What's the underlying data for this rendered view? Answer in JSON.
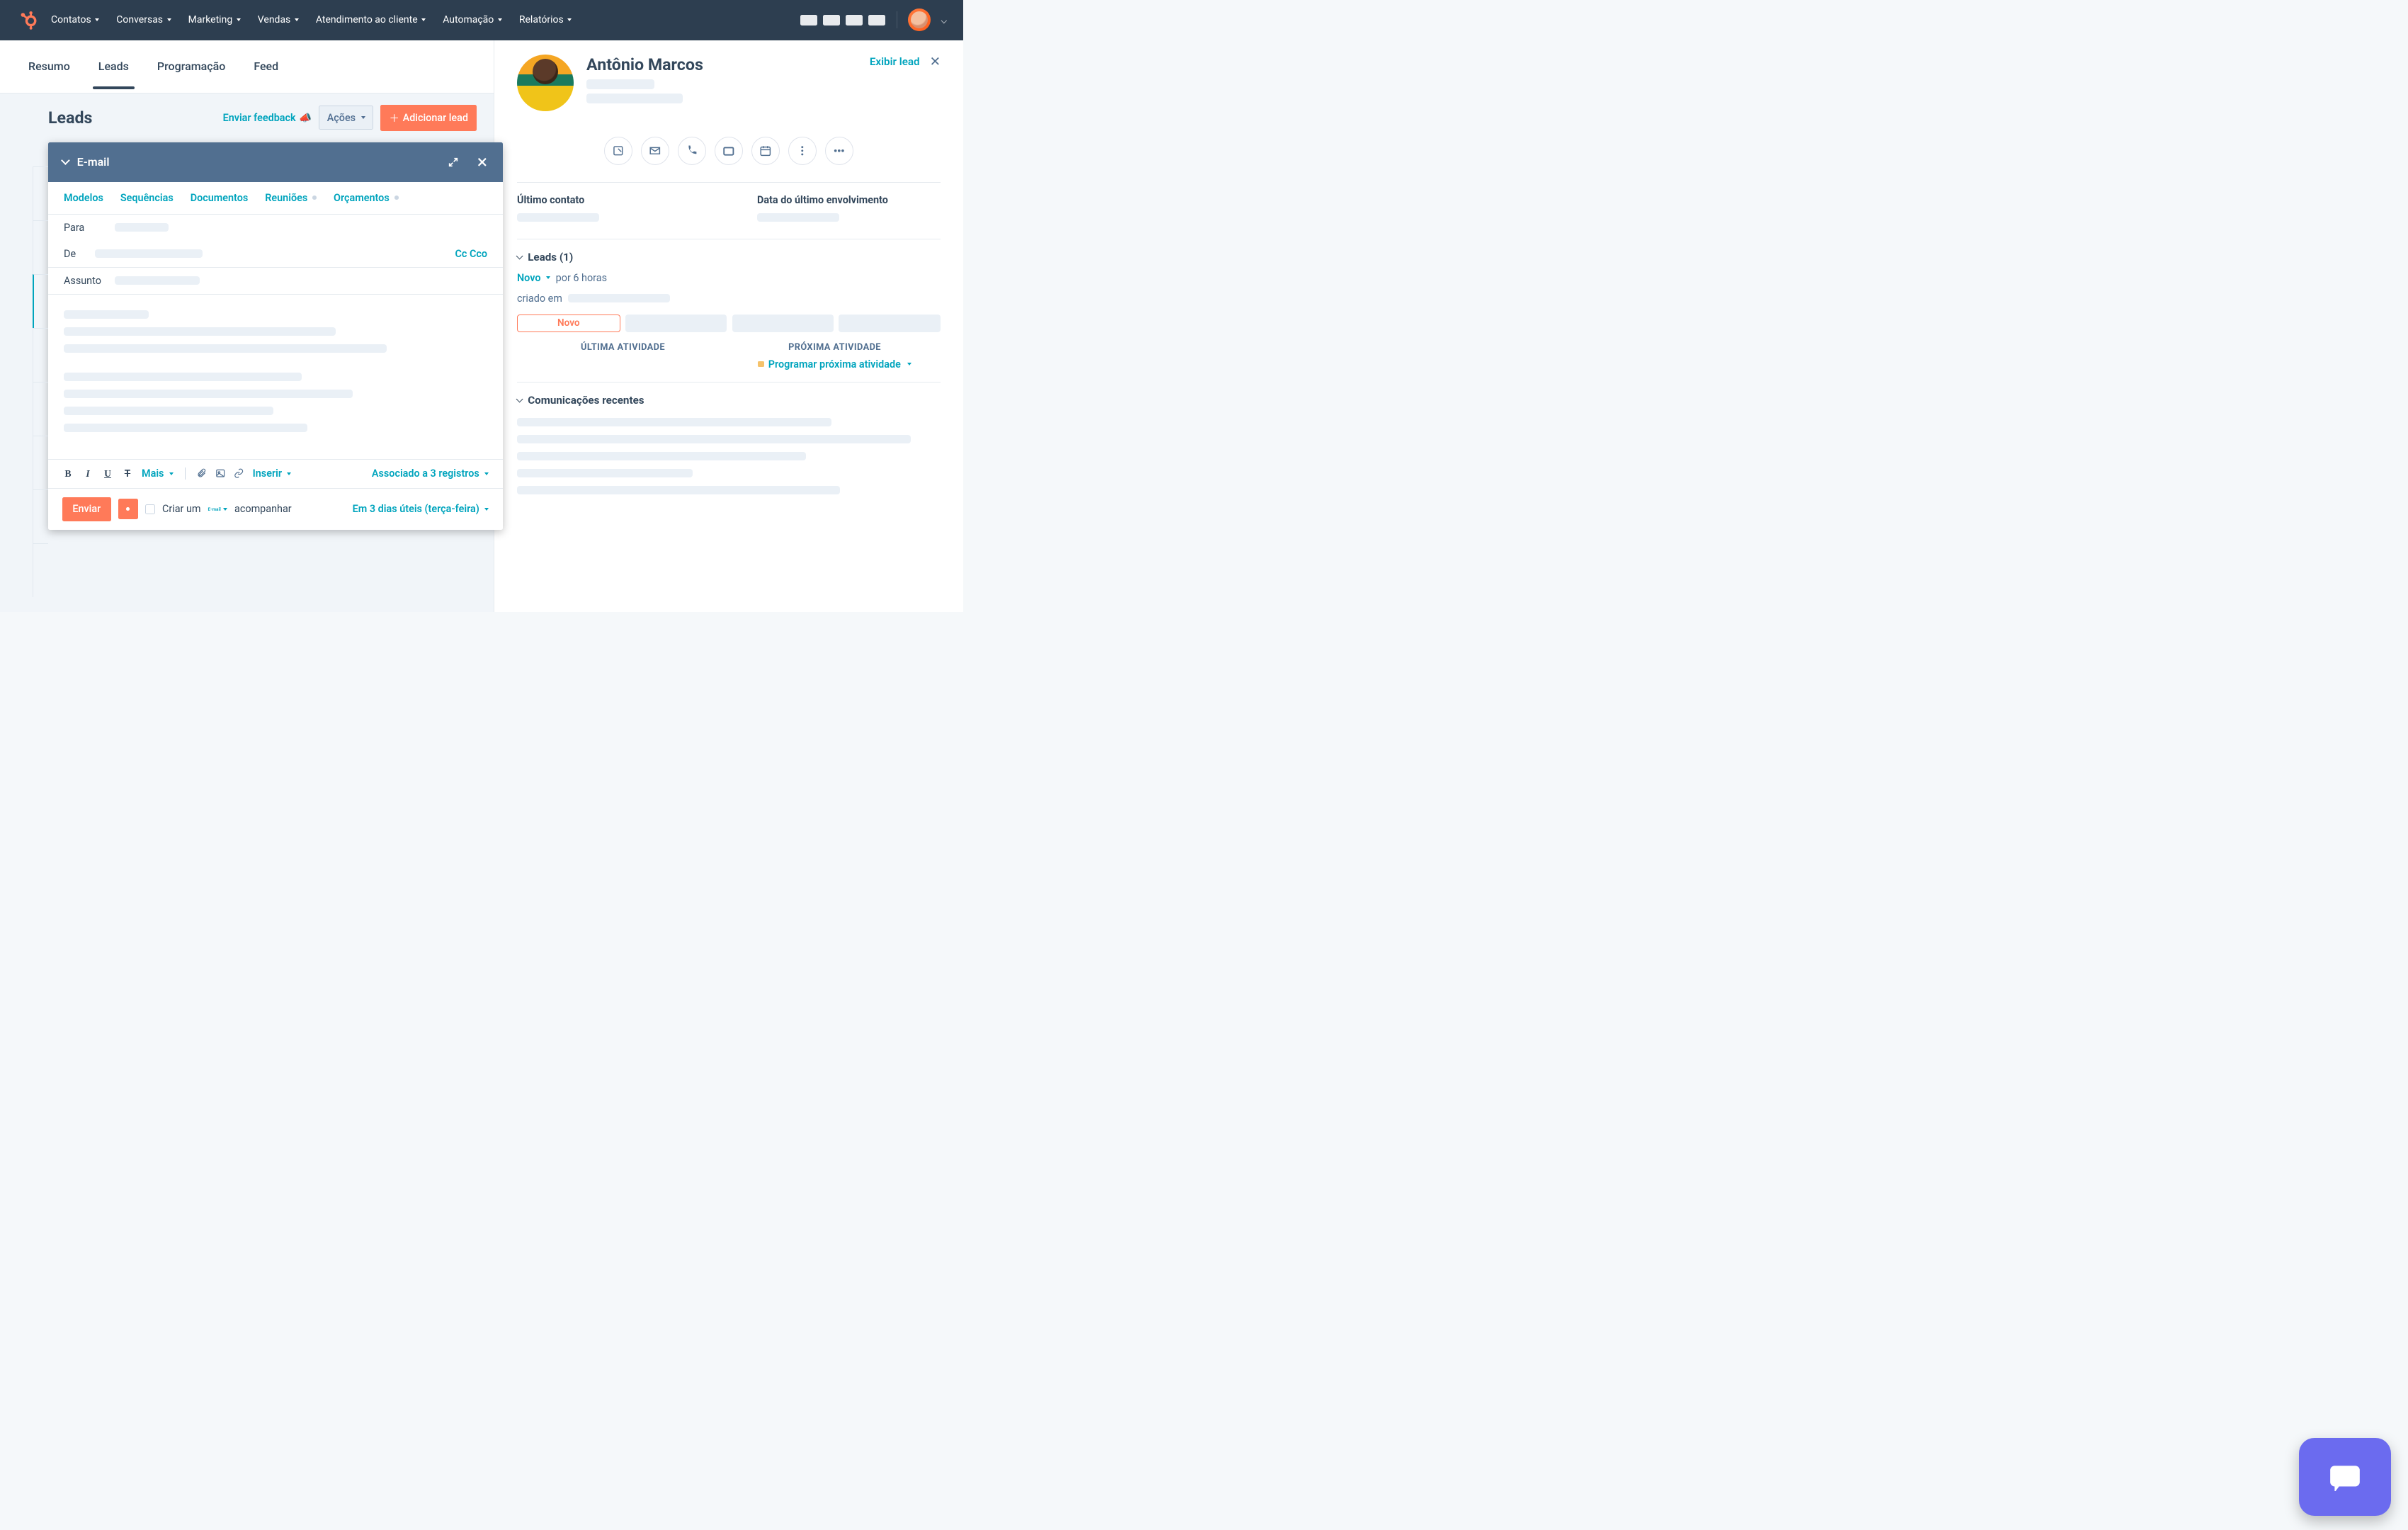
{
  "nav": {
    "items": [
      "Contatos",
      "Conversas",
      "Marketing",
      "Vendas",
      "Atendimento ao cliente",
      "Automação",
      "Relatórios"
    ]
  },
  "tabs": {
    "items": [
      "Resumo",
      "Leads",
      "Programação",
      "Feed"
    ],
    "activeIndex": 1
  },
  "leads": {
    "title": "Leads",
    "feedback": "Enviar feedback",
    "actions": "Ações",
    "add": "Adicionar lead"
  },
  "compose": {
    "title": "E-mail",
    "tabs": [
      "Modelos",
      "Sequências",
      "Documentos",
      "Reuniões",
      "Orçamentos"
    ],
    "toLabel": "Para",
    "fromLabel": "De",
    "cc": "Cc",
    "bcc": "Cco",
    "subjectLabel": "Assunto",
    "more": "Mais",
    "insert": "Inserir",
    "associated": "Associado a 3 registros",
    "send": "Enviar",
    "createA": "Criar um",
    "emailWord": "E-mail",
    "followUp": "acompanhar",
    "schedule": "Em 3 dias úteis (terça-feira)"
  },
  "contact": {
    "name": "Antônio Marcos",
    "viewLead": "Exibir lead",
    "lastContact": "Último contato",
    "lastEngagement": "Data do último envolvimento",
    "leadsSection": "Leads (1)",
    "novo": "Novo",
    "duration": "por 6 horas",
    "createdOn": "criado em",
    "stageNovo": "Novo",
    "lastActivity": "ÚLTIMA ATIVIDADE",
    "nextActivity": "PRÓXIMA ATIVIDADE",
    "scheduleNext": "Programar próxima atividade",
    "recentComms": "Comunicações recentes"
  }
}
